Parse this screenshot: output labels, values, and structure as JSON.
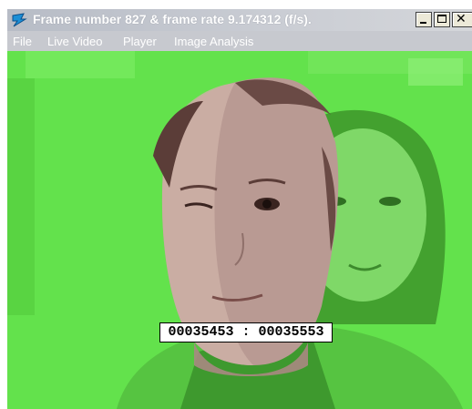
{
  "window": {
    "title": "Frame number 827 & frame rate 9.174312 (f/s).",
    "icon": "app-icon"
  },
  "menubar": {
    "items": [
      {
        "label": "File"
      },
      {
        "label": "Live Video"
      },
      {
        "label": "Player"
      },
      {
        "label": "Image Analysis"
      }
    ]
  },
  "video": {
    "overlay_color": "#63e24c",
    "timecode": "00035453 : 00035553"
  },
  "colors": {
    "titlebar": "#c0c4cc",
    "menubar": "#c7c9cf",
    "green_overlay": "#63e24c",
    "face_tone": "#b99a93"
  }
}
